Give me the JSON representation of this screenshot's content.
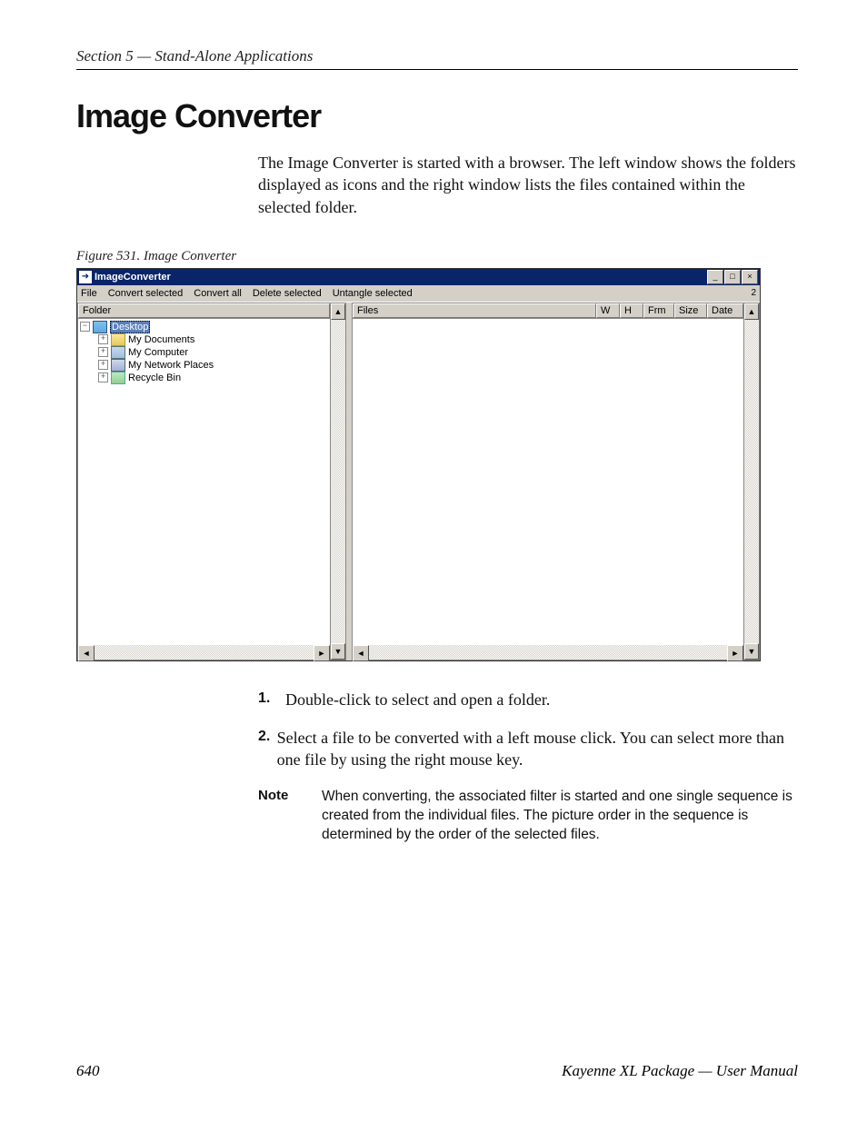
{
  "header": {
    "section_line": "Section 5 — Stand-Alone Applications"
  },
  "title": "Image Converter",
  "intro": "The Image Converter is started with a browser. The left window shows the folders displayed as icons and the right window lists the files contained within the selected folder.",
  "figure_caption": "Figure 531.  Image Converter",
  "app": {
    "title": "ImageConverter",
    "menus": [
      "File",
      "Convert selected",
      "Convert all",
      "Delete selected",
      "Untangle selected"
    ],
    "window_controls": {
      "minimize": "_",
      "maximize": "□",
      "close": "×"
    },
    "status_corner": "2",
    "left": {
      "header": "Folder",
      "tree": {
        "root": "Desktop",
        "children": [
          {
            "label": "My Documents",
            "icon": "folder"
          },
          {
            "label": "My Computer",
            "icon": "computer"
          },
          {
            "label": "My Network Places",
            "icon": "network"
          },
          {
            "label": "Recycle Bin",
            "icon": "recycle"
          }
        ]
      }
    },
    "right": {
      "columns": [
        "Files",
        "W",
        "H",
        "Frm",
        "Size",
        "Date"
      ]
    },
    "scroll_glyphs": {
      "up": "▲",
      "down": "▼",
      "left": "◄",
      "right": "►"
    }
  },
  "steps": {
    "s1_num": "1.",
    "s1_text": "Double-click to select and open a folder.",
    "s2_num": "2.",
    "s2_text": "Select a file to be converted with a left mouse click. You can select more than one file by using the right mouse key."
  },
  "note": {
    "label": "Note",
    "body": "When converting, the associated filter is started and one single sequence is created from the individual files. The picture order in the sequence is determined by the order of the selected files."
  },
  "footer": {
    "page": "640",
    "book": "Kayenne XL Package — User Manual"
  }
}
